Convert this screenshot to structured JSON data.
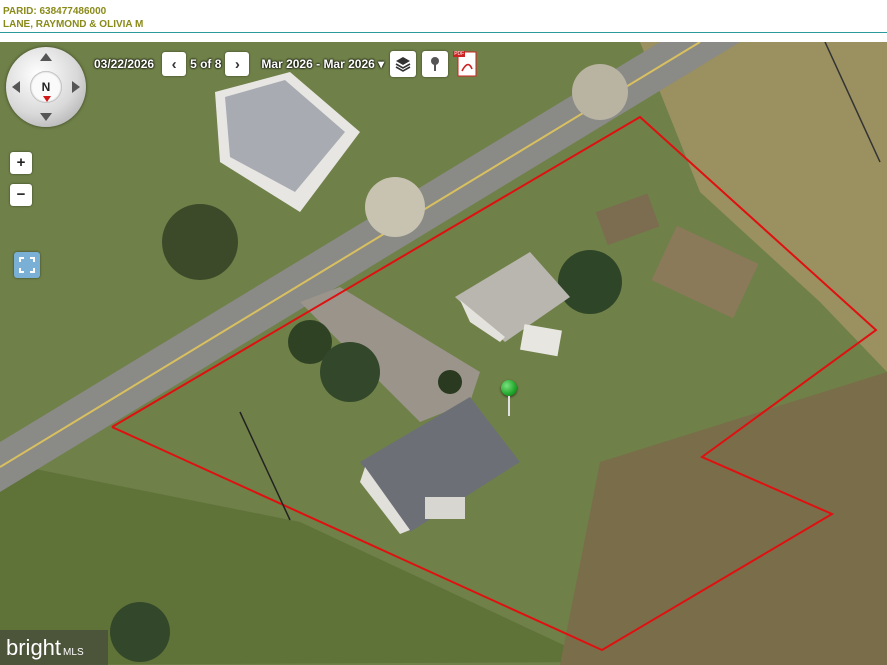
{
  "header": {
    "parid": "PARID: 638477486000",
    "owner": "LANE, RAYMOND & OLIVIA M"
  },
  "imagery": {
    "date": "03/22/2026",
    "counter": "5 of 8",
    "range": "Mar 2026 - Mar 2026",
    "range_caret": "▾"
  },
  "compass": {
    "north_label": "N"
  },
  "zoom": {
    "in_label": "+",
    "out_label": "−"
  },
  "icons": {
    "prev": "chevron-left-icon",
    "next": "chevron-right-icon",
    "layers": "layers-icon",
    "pin": "pin-icon",
    "pdf": "pdf-icon",
    "extent": "fullscreen-icon",
    "marker": "location-marker-icon"
  },
  "pdf_badge": "PDF",
  "watermark": {
    "brand": "bright",
    "suffix": "MLS"
  },
  "colors": {
    "header_text": "#8a8a1a",
    "header_rule": "#2c9a9a",
    "parcel_outline": "#e01010",
    "marker": "#1fa82a"
  }
}
